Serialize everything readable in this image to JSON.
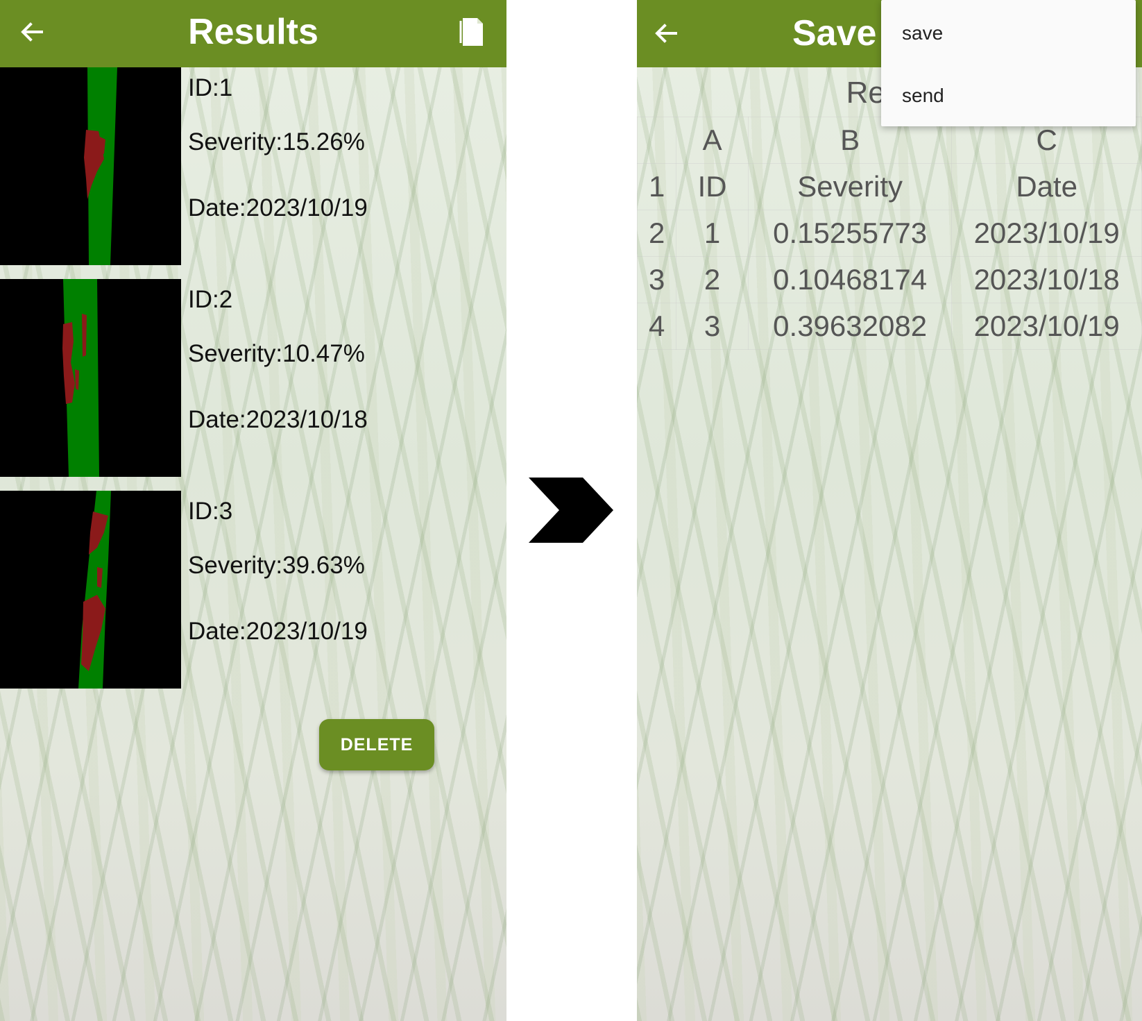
{
  "left_screen": {
    "title": "Results",
    "icons": {
      "back": "arrow-left-icon",
      "action": "document-icon"
    },
    "results": [
      {
        "id_text": "ID:1",
        "severity_text": "Severity:15.26%",
        "date_text": "Date:2023/10/19"
      },
      {
        "id_text": "ID:2",
        "severity_text": "Severity:10.47%",
        "date_text": "Date:2023/10/18"
      },
      {
        "id_text": "ID:3",
        "severity_text": "Severity:39.63%",
        "date_text": "Date:2023/10/19"
      }
    ],
    "delete_label": "DELETE"
  },
  "transition_icon": "chevron-right-icon",
  "right_screen": {
    "title": "Save",
    "sheet_title": "Result",
    "column_letters": [
      "A",
      "B",
      "C"
    ],
    "rows": [
      {
        "num": "1",
        "a": "ID",
        "b": "Severity",
        "c": "Date"
      },
      {
        "num": "2",
        "a": "1",
        "b": "0.15255773",
        "c": "2023/10/19"
      },
      {
        "num": "3",
        "a": "2",
        "b": "0.10468174",
        "c": "2023/10/18"
      },
      {
        "num": "4",
        "a": "3",
        "b": "0.39632082",
        "c": "2023/10/19"
      }
    ],
    "menu": {
      "items": [
        "save",
        "send"
      ]
    }
  },
  "colors": {
    "app_bar": "#6b8e23",
    "leaf_healthy": "#008000",
    "leaf_lesion": "#8b1a1a",
    "thumbnail_background": "#000000"
  }
}
